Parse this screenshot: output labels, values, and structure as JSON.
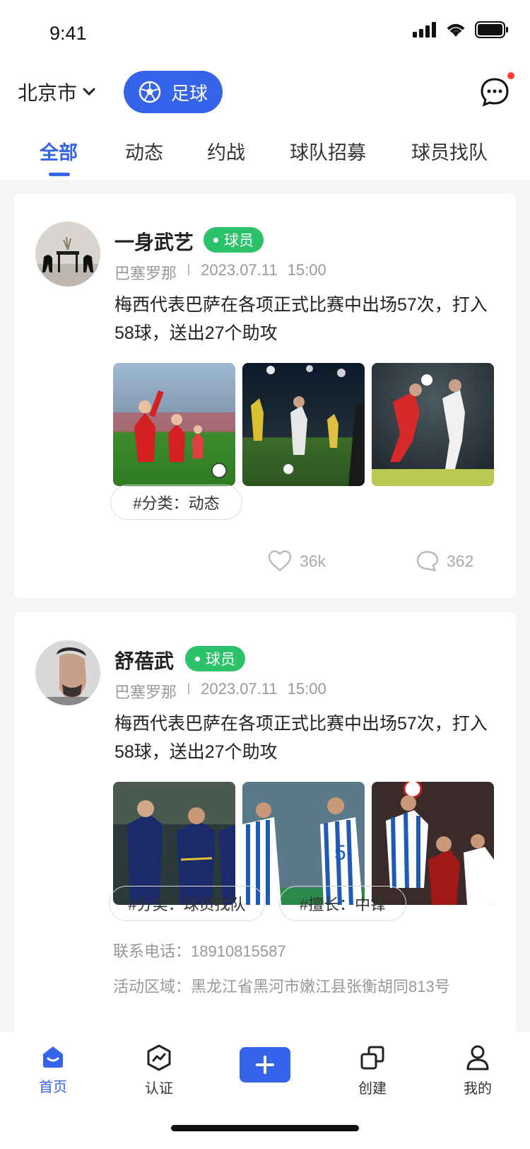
{
  "status_bar": {
    "time": "9:41"
  },
  "header": {
    "city": "北京市",
    "sport": "足球"
  },
  "tabs": [
    {
      "label": "全部",
      "active": true
    },
    {
      "label": "动态",
      "active": false
    },
    {
      "label": "约战",
      "active": false
    },
    {
      "label": "球队招募",
      "active": false
    },
    {
      "label": "球员找队",
      "active": false
    }
  ],
  "posts": [
    {
      "name": "一身武艺",
      "role": "球员",
      "location": "巴塞罗那",
      "separator": "I",
      "date": "2023.07.11",
      "time": "15:00",
      "text": "梅西代表巴萨在各项正式比赛中出场57次，打入58球，送出27个助攻",
      "tags": [
        "#分类：动态"
      ],
      "likes": "36k",
      "comments": "362"
    },
    {
      "name": "舒蓓武",
      "role": "球员",
      "location": "巴塞罗那",
      "separator": "I",
      "date": "2023.07.11",
      "time": "15:00",
      "text": "梅西代表巴萨在各项正式比赛中出场57次，打入58球，送出27个助攻",
      "tags": [
        "#分类：球员找队",
        "#擅长：中锋"
      ],
      "phone": "联系电话：18910815587",
      "area": "活动区域：黑龙江省黑河市嫩江县张衡胡同813号"
    }
  ],
  "tabbar": {
    "items": [
      {
        "label": "首页",
        "icon": "home-icon",
        "active": true
      },
      {
        "label": "认证",
        "icon": "certify-icon",
        "active": false
      },
      {
        "label": "创建",
        "icon": "create-icon",
        "active": false
      },
      {
        "label": "我的",
        "icon": "profile-icon",
        "active": false
      }
    ]
  },
  "colors": {
    "accent": "#3563e9",
    "badge": "#2bc26a",
    "notice": "#ff3b30"
  }
}
